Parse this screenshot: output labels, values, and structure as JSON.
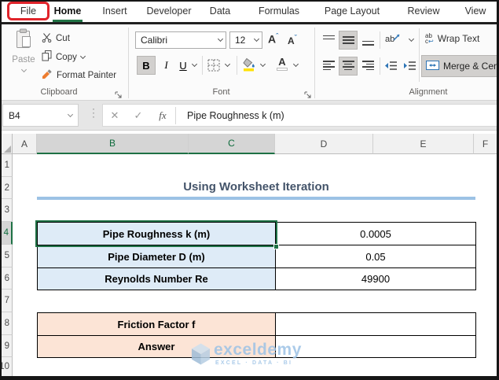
{
  "window": {
    "tabs": [
      "File",
      "Home",
      "Insert",
      "Developer",
      "Data",
      "Formulas",
      "Page Layout",
      "Review",
      "View"
    ],
    "active_tab": "Home"
  },
  "ribbon": {
    "clipboard": {
      "label": "Clipboard",
      "paste": "Paste",
      "cut": "Cut",
      "copy": "Copy",
      "format_painter": "Format Painter"
    },
    "font": {
      "label": "Font",
      "font_name": "Calibri",
      "font_size": "12",
      "bold": "B",
      "italic": "I",
      "underline": "U"
    },
    "alignment": {
      "label": "Alignment",
      "wrap_text": "Wrap Text",
      "merge_center": "Merge & Center"
    }
  },
  "formula_bar": {
    "name_box": "B4",
    "fx": "fx",
    "content": "Pipe Roughness k (m)"
  },
  "grid": {
    "columns": [
      "A",
      "B",
      "C",
      "D",
      "E",
      "F"
    ],
    "rows": [
      "1",
      "2",
      "3",
      "4",
      "5",
      "6",
      "7",
      "8",
      "9",
      "10"
    ],
    "selected_cell": "B4",
    "selected_columns": "B,C",
    "selected_row": "4"
  },
  "sheet": {
    "title": "Using Worksheet Iteration",
    "input_table": [
      {
        "label": "Pipe Roughness k (m)",
        "value": "0.0005"
      },
      {
        "label": "Pipe Diameter D (m)",
        "value": "0.05"
      },
      {
        "label": "Reynolds Number Re",
        "value": "49900"
      }
    ],
    "output_table": [
      {
        "label": "Friction Factor f",
        "value": ""
      },
      {
        "label": "Answer",
        "value": ""
      }
    ]
  },
  "watermark": {
    "brand": "exceldemy",
    "tagline": "EXCEL · DATA · BI"
  },
  "colors": {
    "excel_green": "#217346",
    "selection_green": "#1E7145",
    "input_fill_blue": "#DEEBF7",
    "output_fill_orange": "#FCE4D6",
    "title_text": "#44546A",
    "title_underline": "#9CC2E5",
    "file_highlight_red": "#E0242B",
    "watermark_blue": "#9DC3E6"
  }
}
